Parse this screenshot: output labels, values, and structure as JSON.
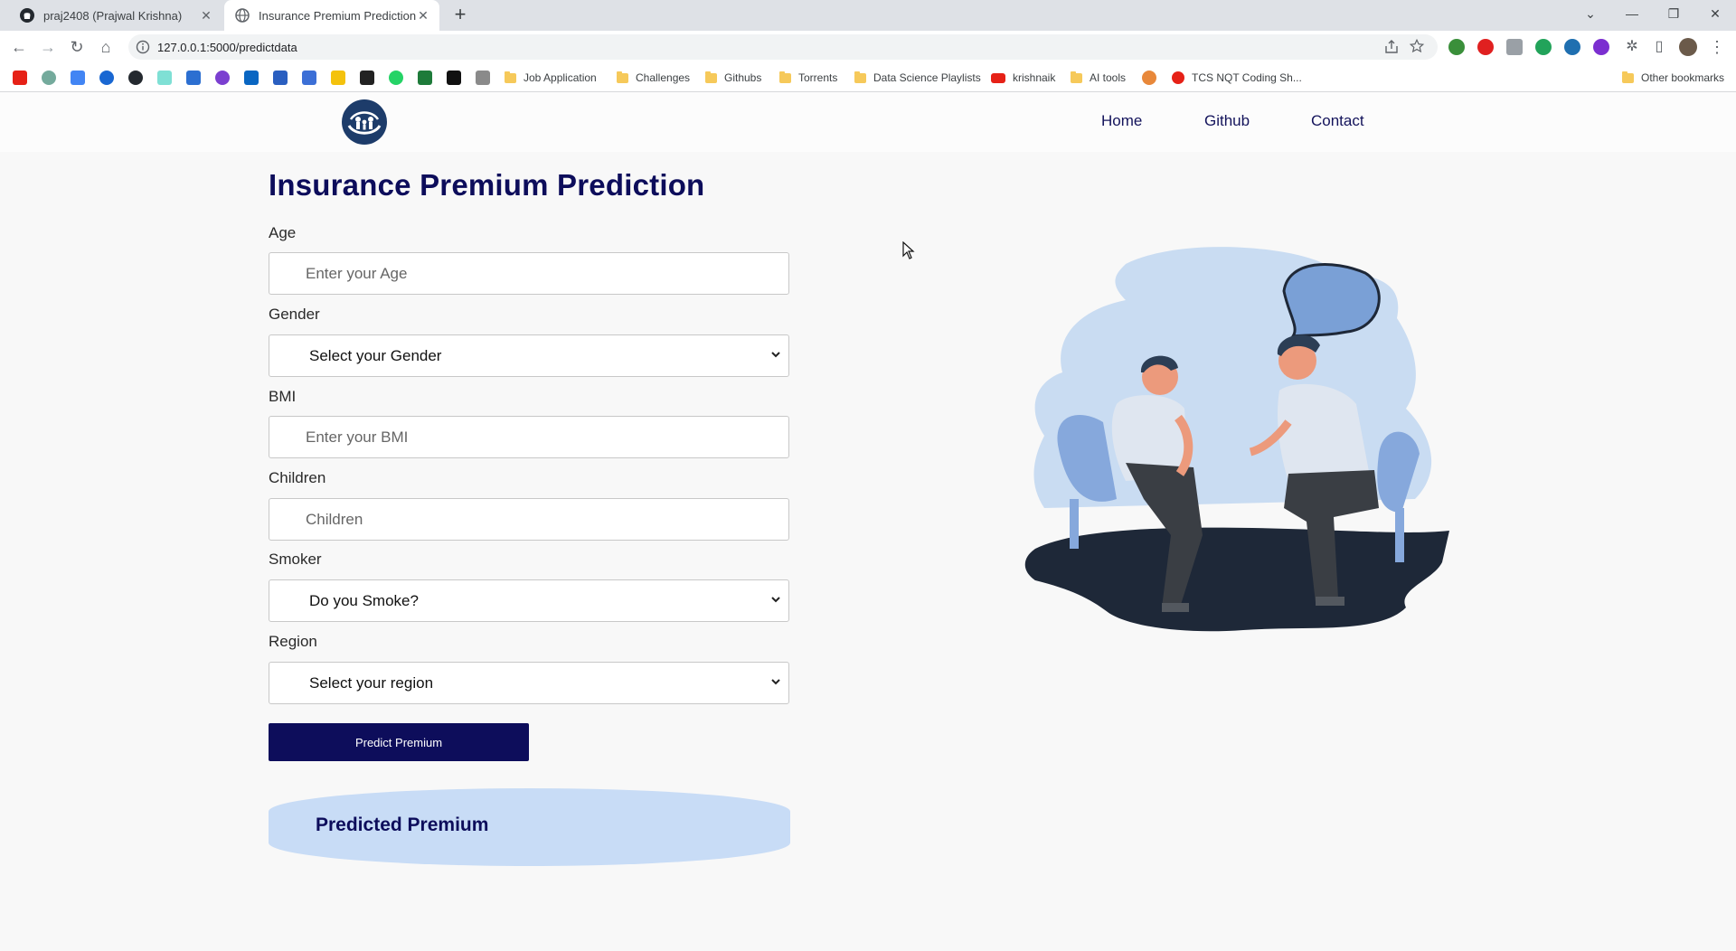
{
  "browser": {
    "tabs": [
      {
        "title": "praj2408 (Prajwal Krishna)",
        "icon": "github-icon",
        "active": false
      },
      {
        "title": "Insurance Premium Prediction W",
        "icon": "globe-icon",
        "active": true
      }
    ],
    "url": "127.0.0.1:5000/predictdata",
    "bookmarks": [
      {
        "label": "Job Application",
        "icon": "folder-icon"
      },
      {
        "label": "Challenges",
        "icon": "folder-icon"
      },
      {
        "label": "Githubs",
        "icon": "folder-icon"
      },
      {
        "label": "Torrents",
        "icon": "folder-icon"
      },
      {
        "label": "Data Science Playlists",
        "icon": "folder-icon"
      },
      {
        "label": "krishnaik",
        "icon": "youtube-icon"
      },
      {
        "label": "AI tools",
        "icon": "folder-icon"
      },
      {
        "label": "TCS NQT Coding Sh...",
        "icon": "site-icon"
      }
    ],
    "other_bookmarks": "Other bookmarks"
  },
  "site": {
    "logo": "family-care-logo",
    "nav": [
      "Home",
      "Github",
      "Contact"
    ]
  },
  "form": {
    "title": "Insurance Premium Prediction",
    "age": {
      "label": "Age",
      "placeholder": "Enter your Age"
    },
    "gender": {
      "label": "Gender",
      "selected": "Select your Gender"
    },
    "bmi": {
      "label": "BMI",
      "placeholder": "Enter your BMI"
    },
    "children": {
      "label": "Children",
      "placeholder": "Children"
    },
    "smoker": {
      "label": "Smoker",
      "selected": "Do you Smoke?"
    },
    "region": {
      "label": "Region",
      "selected": "Select your region"
    },
    "submit": "Predict Premium"
  },
  "result": {
    "label": "Predicted Premium"
  },
  "illustration": "two-people-conversation-illustration",
  "colors": {
    "brand": "#0d0d5b",
    "result_bg": "#c8dcf6",
    "accent_blue": "#7aa0d6"
  }
}
